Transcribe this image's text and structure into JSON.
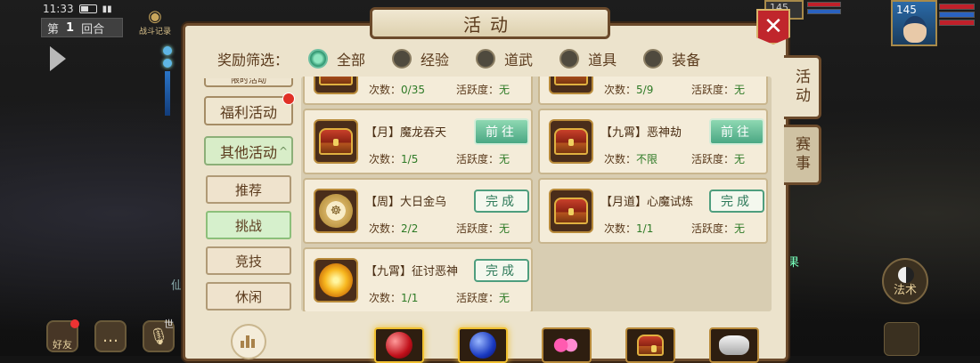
{
  "status": {
    "time": "11:33"
  },
  "round": {
    "prefix": "第",
    "number": "1",
    "suffix": "回合"
  },
  "battle_log": {
    "label": "战斗记录"
  },
  "bottom_left": {
    "friends_label": "好友",
    "voice_channel": "世"
  },
  "player": {
    "level": "145"
  },
  "pet": {
    "level": "145"
  },
  "side_glyphs": {
    "left": "仙",
    "right": "果"
  },
  "rules_button": {
    "label": "法术"
  },
  "panel": {
    "title": "活动",
    "close_symbol": "✕",
    "filter": {
      "label": "奖励筛选：",
      "options": [
        "全部",
        "经验",
        "道武",
        "道具",
        "装备"
      ],
      "selected": "全部"
    },
    "side_tabs": [
      "活动",
      "赛事"
    ],
    "categories": {
      "partial_label": "限时活动",
      "welfare": "福利活动",
      "other": "其他活动",
      "other_caret": "^"
    },
    "sub_categories": [
      "推荐",
      "挑战",
      "竞技",
      "休闲"
    ],
    "selected_sub": "挑战",
    "labels": {
      "count": "次数：",
      "activity": "活跃度：",
      "go": "前往",
      "done": "完成"
    },
    "cards": [
      {
        "name": "",
        "count": "0/35",
        "activity": "无",
        "icon": "chest-icon",
        "button": ""
      },
      {
        "name": "",
        "count": "5/9",
        "activity": "无",
        "icon": "chest-icon",
        "button": ""
      },
      {
        "name": "【月】魔龙吞天",
        "count": "1/5",
        "activity": "无",
        "icon": "chest-icon",
        "button": "go"
      },
      {
        "name": "【九霄】恶神劫",
        "count": "不限",
        "activity": "无",
        "icon": "chest-icon",
        "button": "go"
      },
      {
        "name": "【周】大日金乌",
        "count": "2/2",
        "activity": "无",
        "icon": "coin-icon",
        "button": "done"
      },
      {
        "name": "【月道】心魔试炼",
        "count": "1/1",
        "activity": "无",
        "icon": "chest-icon",
        "button": "done"
      },
      {
        "name": "【九霄】征讨恶神",
        "count": "1/1",
        "activity": "无",
        "icon": "fireball-icon",
        "button": "done"
      }
    ],
    "rewards": [
      "red-orb-icon",
      "blue-orb-icon",
      "gems-icon",
      "chest-icon",
      "silver-ingot-icon"
    ]
  }
}
